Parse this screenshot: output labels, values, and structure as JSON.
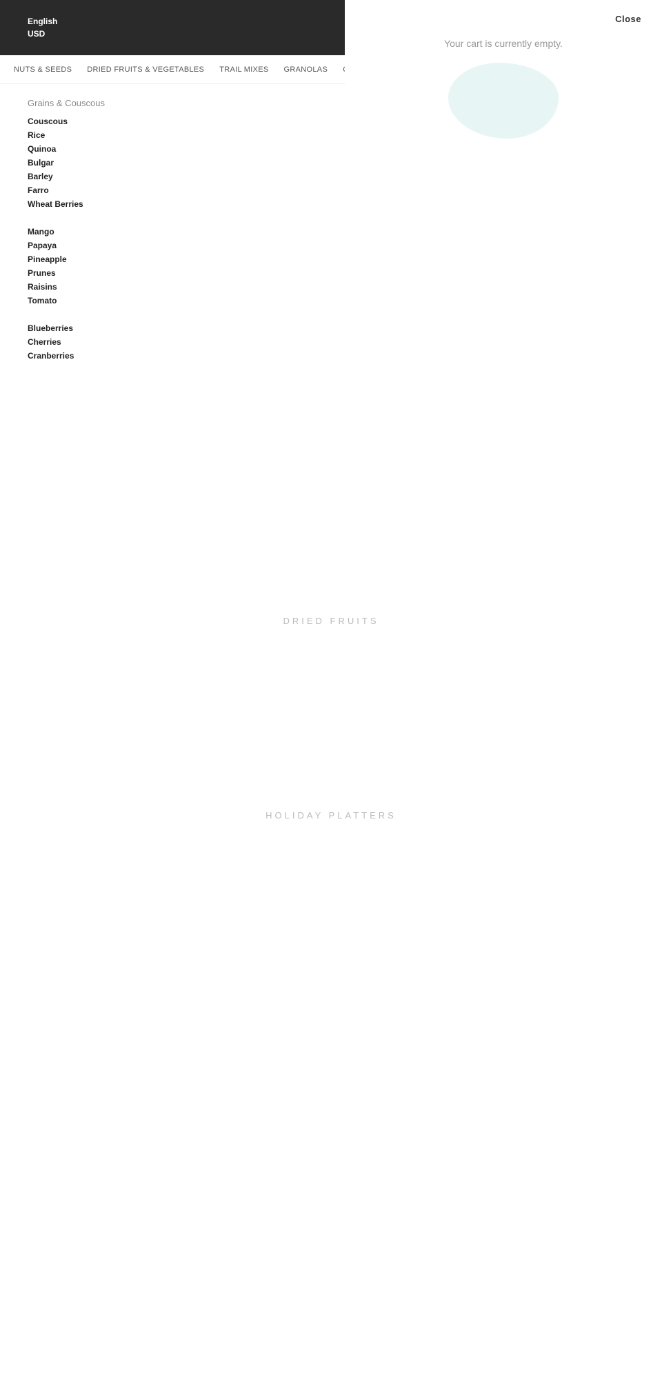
{
  "top_bar": {
    "language": "English",
    "currency": "USD"
  },
  "cart": {
    "close_label": "Close",
    "empty_text": "Your cart is currently empty."
  },
  "nav": {
    "items": [
      {
        "label": "NUTS & SEEDS",
        "id": "nuts-seeds"
      },
      {
        "label": "DRIED FRUITS & VEGETABLES",
        "id": "dried-fruits"
      },
      {
        "label": "TRAIL MIXES",
        "id": "trail-mixes"
      },
      {
        "label": "GRANOLAS",
        "id": "granolas"
      },
      {
        "label": "CHOCOLATES",
        "id": "chocolates"
      }
    ]
  },
  "dropdown": {
    "grains_title": "Grains & Couscous",
    "grains_items": [
      "Couscous",
      "Rice",
      "Quinoa",
      "Bulgar",
      "Barley",
      "Farro",
      "Wheat Berries"
    ],
    "tropical_items": [
      "Mango",
      "Papaya",
      "Pineapple",
      "Prunes",
      "Raisins",
      "Tomato"
    ],
    "berries_items": [
      "Blueberries",
      "Cherries",
      "Cranberries"
    ]
  },
  "sections": {
    "dried_fruits_label": "DRIED FRUITS",
    "holiday_platters_label": "HOLIDAY PLATTERS"
  }
}
